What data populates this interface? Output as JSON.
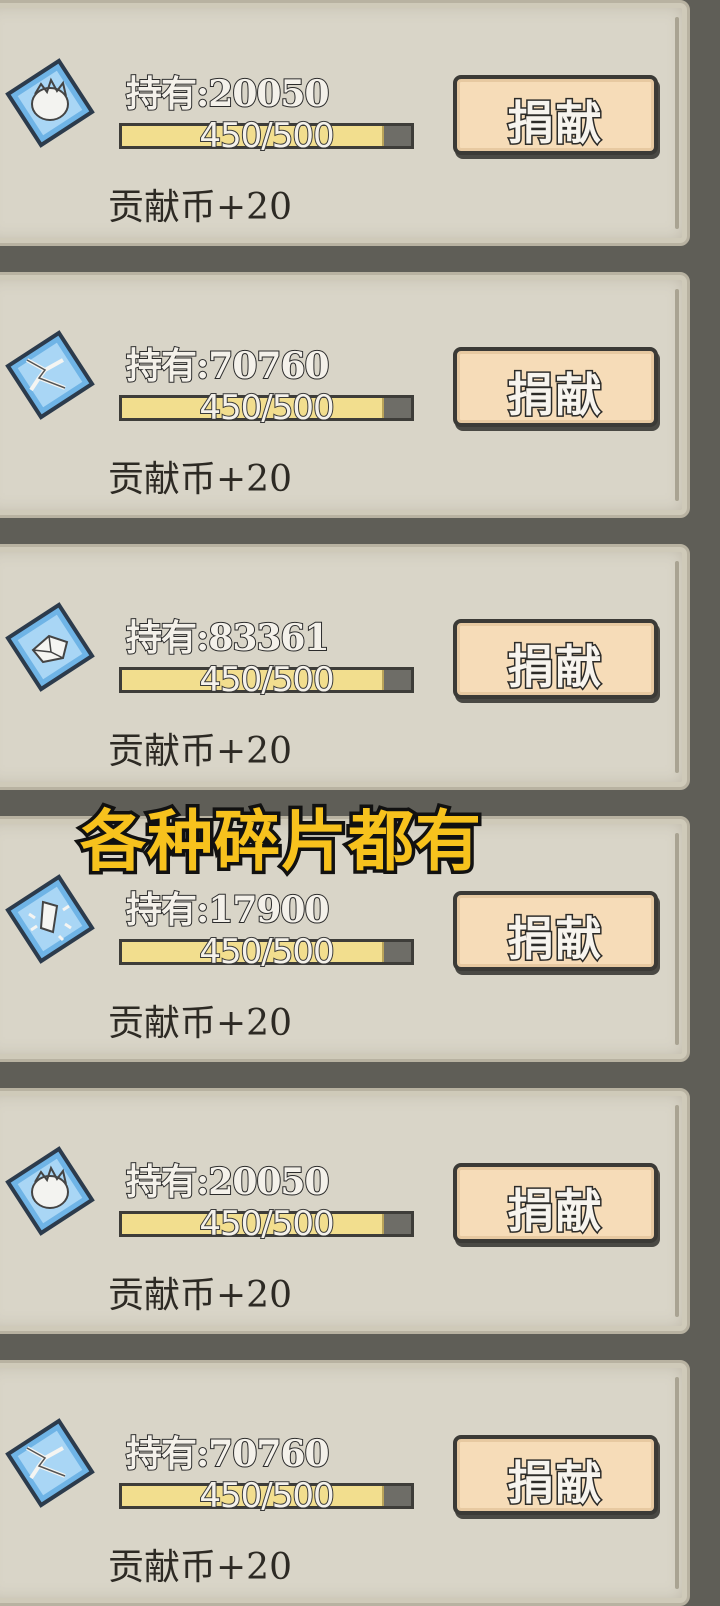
{
  "colors": {
    "panel": "#d9d5c8",
    "button": "#f6dcb8",
    "progress_fill": "#f2de8e",
    "caption": "#f7c21d"
  },
  "donate_label": "捐献",
  "items": [
    {
      "icon": "feather-burst-fragment-icon",
      "owned": "持有:20050",
      "progress": "450/500",
      "progress_ratio": 0.9,
      "reward": "贡献币+20"
    },
    {
      "icon": "lightning-fragment-icon",
      "owned": "持有:70760",
      "progress": "450/500",
      "progress_ratio": 0.9,
      "reward": "贡献币+20"
    },
    {
      "icon": "cube-shard-fragment-icon",
      "owned": "持有:83361",
      "progress": "450/500",
      "progress_ratio": 0.9,
      "reward": "贡献币+20"
    },
    {
      "icon": "ice-shatter-fragment-icon",
      "owned": "持有:17900",
      "progress": "450/500",
      "progress_ratio": 0.9,
      "reward": "贡献币+20"
    },
    {
      "icon": "feather-burst-fragment-icon",
      "owned": "持有:20050",
      "progress": "450/500",
      "progress_ratio": 0.9,
      "reward": "贡献币+20"
    },
    {
      "icon": "lightning-fragment-icon",
      "owned": "持有:70760",
      "progress": "450/500",
      "progress_ratio": 0.9,
      "reward": "贡献币+20"
    }
  ],
  "caption": "各种碎片都有"
}
